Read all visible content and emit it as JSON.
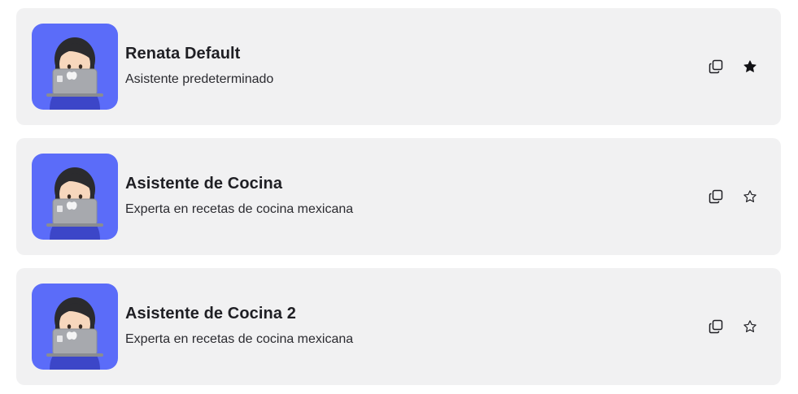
{
  "assistants": [
    {
      "name": "Renata Default",
      "description": "Asistente predeterminado",
      "favorite": true
    },
    {
      "name": "Asistente de Cocina",
      "description": "Experta en recetas de cocina mexicana",
      "favorite": false
    },
    {
      "name": "Asistente de Cocina 2",
      "description": "Experta en recetas de cocina mexicana",
      "favorite": false
    }
  ],
  "colors": {
    "card_background": "#f1f1f2",
    "avatar_background": "#5b6cf9",
    "text": "#1f1f24"
  },
  "icons": {
    "avatar": "woman-technologist-emoji",
    "copy": "copy-icon",
    "favorite_on": "star-filled-icon",
    "favorite_off": "star-outline-icon"
  }
}
